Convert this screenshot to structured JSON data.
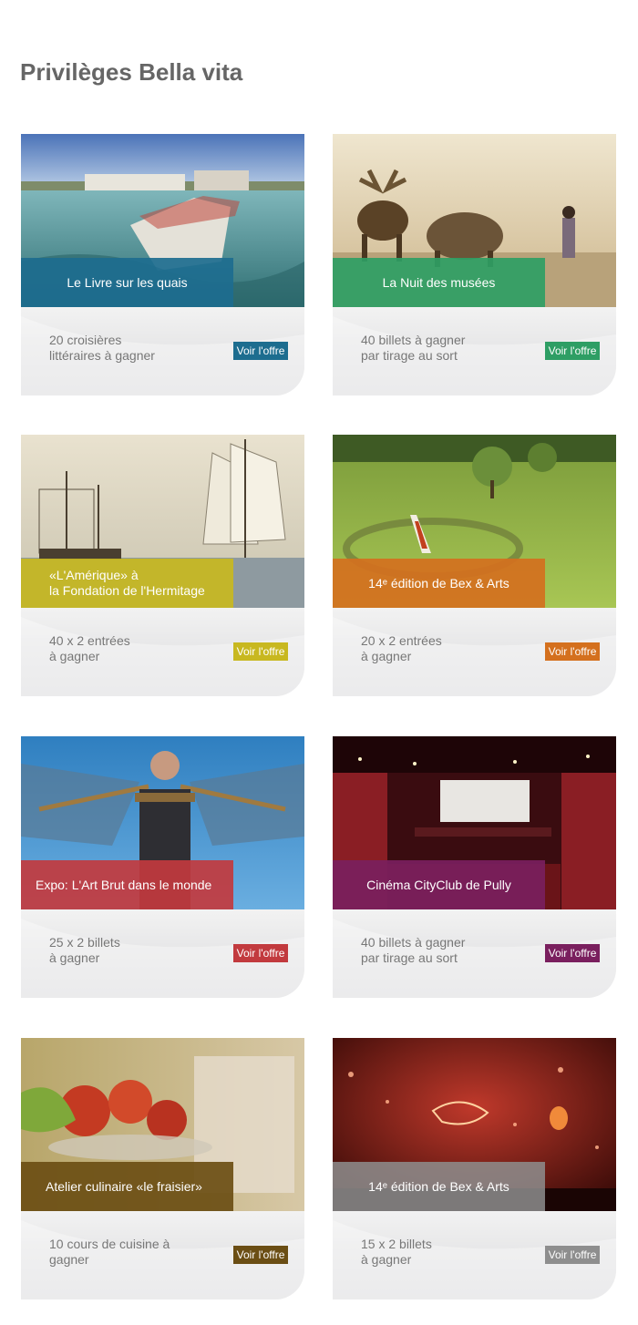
{
  "page": {
    "title": "Privilèges Bella vita"
  },
  "cards": [
    {
      "caption": [
        "Le Livre sur les quais"
      ],
      "offer": [
        "20 croisières",
        "littéraires à gagner"
      ],
      "button": "Voir l'offre",
      "color": "#1d6d8f"
    },
    {
      "caption": [
        "La Nuit des musées"
      ],
      "offer": [
        "40 billets à gagner",
        "par tirage au sort"
      ],
      "button": "Voir l'offre",
      "color": "#2e9e64"
    },
    {
      "caption": [
        "«L'Amérique» à",
        "la Fondation de l'Hermitage"
      ],
      "offer": [
        "40 x 2 entrées",
        "à gagner"
      ],
      "button": "Voir l'offre",
      "color": "#c8b820"
    },
    {
      "caption": [
        "14ᵉ édition de Bex & Arts"
      ],
      "offer": [
        "20 x 2 entrées",
        "à gagner"
      ],
      "button": "Voir l'offre",
      "color": "#d4701e"
    },
    {
      "caption": [
        "Expo: L'Art Brut dans le monde"
      ],
      "offer": [
        "25 x 2 billets",
        "à gagner"
      ],
      "button": "Voir l'offre",
      "color": "#c23a3e"
    },
    {
      "caption": [
        "Cinéma CityClub de Pully"
      ],
      "offer": [
        "40 billets à gagner",
        "par tirage au sort"
      ],
      "button": "Voir l'offre",
      "color": "#7a1f5e"
    },
    {
      "caption": [
        "Atelier culinaire «le fraisier»"
      ],
      "offer": [
        "10 cours de cuisine à",
        "gagner"
      ],
      "button": "Voir l'offre",
      "color": "#6b4e14"
    },
    {
      "caption": [
        "14ᵉ édition de Bex & Arts"
      ],
      "offer": [
        "15 x 2 billets",
        "à gagner"
      ],
      "button": "Voir l'offre",
      "color": "#8e8e8e"
    }
  ]
}
